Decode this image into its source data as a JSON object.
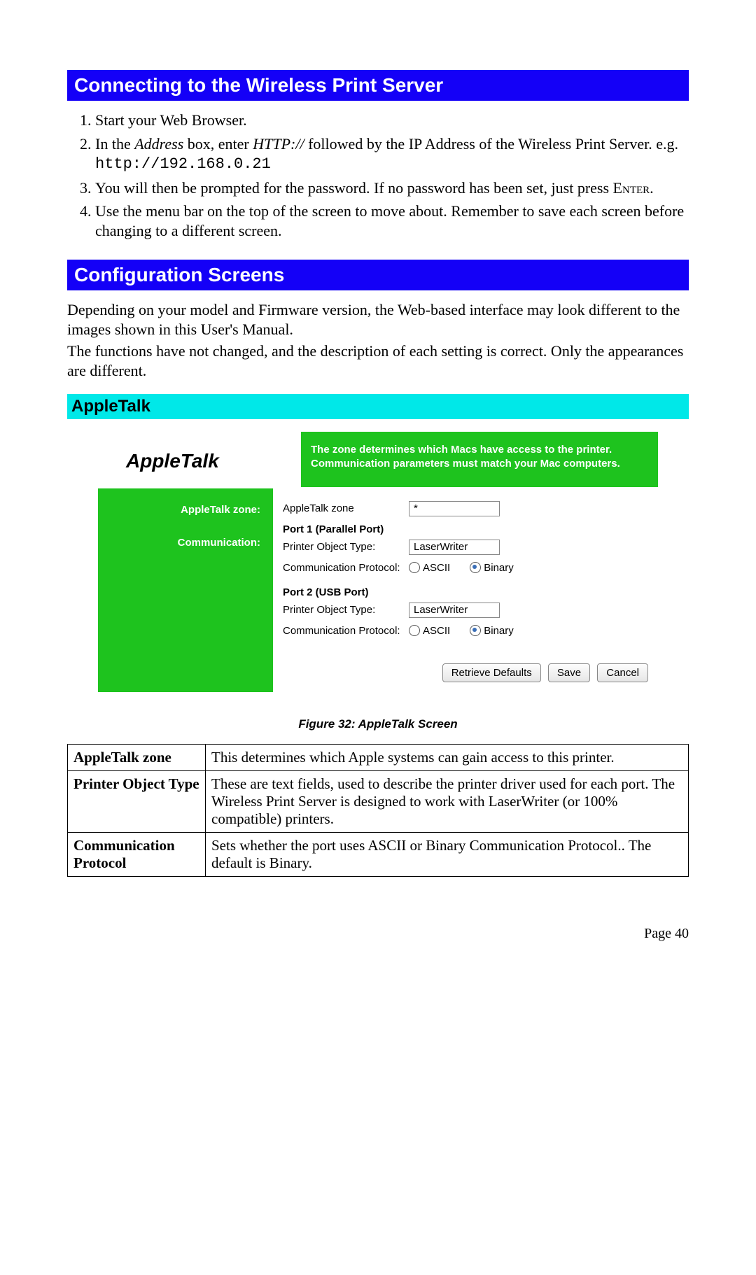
{
  "section1": {
    "title": "Connecting to the Wireless Print Server",
    "steps": {
      "s1": "Start your Web Browser.",
      "s2_a": "In the ",
      "s2_b": "Address",
      "s2_c": " box, enter ",
      "s2_d": "HTTP://",
      "s2_e": " followed by the IP Address of the Wireless Print Server. e.g.",
      "s2_code": "http://192.168.0.21",
      "s3_a": "You will then be prompted for the password. If no password has been set, just press ",
      "s3_b": "Enter",
      "s3_c": ".",
      "s4": "Use the menu bar on the top of the screen to move about. Remember to save each screen before changing to a different screen."
    }
  },
  "section2": {
    "title": "Configuration Screens",
    "p1": "Depending on your model and Firmware version, the Web-based interface may look different to the images shown in this User's Manual.",
    "p2": "The functions have not changed, and the description of each setting is correct. Only the appearances are different."
  },
  "appletalk": {
    "subhead": "AppleTalk",
    "sshot": {
      "title": "AppleTalk",
      "banner1": "The zone determines which Macs have access to the printer.",
      "banner2": "Communication parameters must match your Mac computers.",
      "left_zone": "AppleTalk zone:",
      "left_comm": "Communication:",
      "row_zone_label": "AppleTalk zone",
      "row_zone_value": "*",
      "port1_title": "Port 1 (Parallel Port)",
      "port2_title": "Port 2 (USB Port)",
      "printer_obj_label": "Printer Object Type:",
      "printer_obj_value": "LaserWriter",
      "comm_label": "Communication Protocol:",
      "opt_ascii": "ASCII",
      "opt_binary": "Binary",
      "btn_defaults": "Retrieve Defaults",
      "btn_save": "Save",
      "btn_cancel": "Cancel"
    },
    "figcap": "Figure 32: AppleTalk Screen",
    "table": {
      "r1k": "AppleTalk zone",
      "r1v": "This determines which Apple systems can gain access to this printer.",
      "r2k": "Printer Object Type",
      "r2v": "These are text fields, used to describe the printer driver used for each port. The Wireless Print Server is designed to work with LaserWriter (or 100% compatible) printers.",
      "r3k": "Communication Protocol",
      "r3v": "Sets whether the port uses ASCII or Binary Communication Protocol.. The default is Binary."
    }
  },
  "pagenum": "Page 40"
}
